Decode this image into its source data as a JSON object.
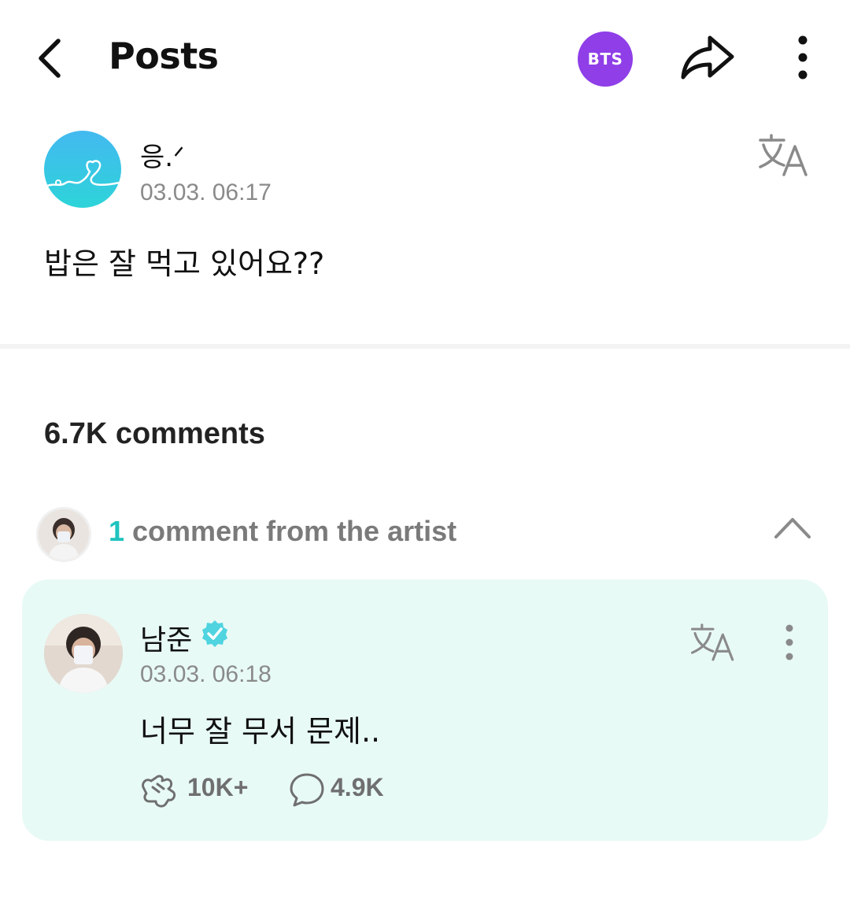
{
  "header": {
    "title": "Posts",
    "back_icon": "chevron-left-icon",
    "community_badge": "BTS",
    "badge_color": "#8f3ee8",
    "share_icon": "share-arrow-icon",
    "more_icon": "vertical-dots-icon"
  },
  "post": {
    "author_name": "응.ᐟ",
    "timestamp": "03.03. 06:17",
    "body": "밥은 잘 먹고 있어요??",
    "translate_icon": "translate-icon"
  },
  "comments": {
    "count_label": "6.7K comments",
    "artist_section": {
      "count": "1",
      "label": " comment from the artist",
      "count_color": "#1fc3be",
      "toggle_icon": "chevron-up-icon"
    },
    "artist_comment": {
      "name": "남준",
      "verified_icon": "verified-badge-icon",
      "timestamp": "03.03. 06:18",
      "body": "너무 잘 무서 문제..",
      "like_count": "10K+",
      "reply_count": "4.9K",
      "card_color": "#e8faf6"
    }
  }
}
